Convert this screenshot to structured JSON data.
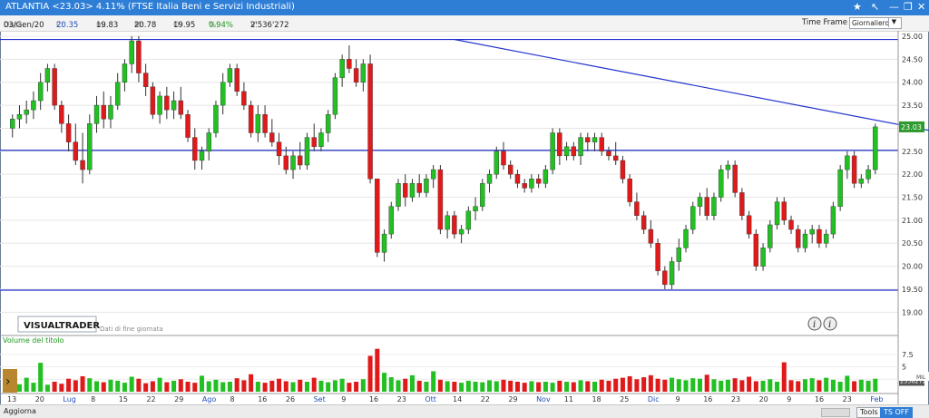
{
  "titlebar": {
    "title": "ATLANTIA <23.03> 4.11% (FTSE Italia Beni e Servizi Industriali)",
    "icons": [
      "star-icon",
      "arrow-nw-icon",
      "minimize-icon",
      "restore-icon",
      "close-icon"
    ]
  },
  "infobar": {
    "date_label": "Data:",
    "date": "03/Gen/20",
    "close_label": "C:",
    "close": "20.35",
    "min_label": "m:",
    "min": "19.83",
    "max_label": "M:",
    "max": "20.78",
    "open_label": "O:",
    "open": "19.95",
    "pct_label": "%:",
    "pct": "0.94%",
    "vol_label": "V:",
    "vol": "2'536'272",
    "timeframe_label": "Time Frame",
    "timeframe_value": "Giornaliero"
  },
  "branding": {
    "logo": "VISUALTRADER",
    "note": "Dati di fine giornata"
  },
  "volume_label": "Volume del titolo",
  "bottombar": {
    "update": "Aggiorna",
    "tools": "Tools",
    "tsoff": "TS OFF"
  },
  "colors": {
    "up": "#22c022",
    "down": "#e01a1a",
    "line": "#2233cc",
    "last_bg": "#2c9a2c"
  },
  "chart_data": [
    {
      "type": "candlestick",
      "title": "",
      "ylim": [
        18.75,
        25.0
      ],
      "yticks": [
        "25.00",
        "24.50",
        "24.00",
        "23.50",
        "23.00",
        "22.50",
        "22.00",
        "21.50",
        "21.00",
        "20.50",
        "20.00",
        "19.50",
        "19.00"
      ],
      "last_value_label": "23.03",
      "xticks": [
        "13",
        "20",
        "Lug",
        "8",
        "15",
        "22",
        "29",
        "Ago",
        "8",
        "16",
        "26",
        "Set",
        "9",
        "16",
        "23",
        "Ott",
        "14",
        "22",
        "29",
        "Nov",
        "11",
        "18",
        "25",
        "Dic",
        "9",
        "16",
        "23",
        "20",
        "9",
        "16",
        "23",
        "Feb"
      ],
      "month_ticks": [
        "Lug",
        "Ago",
        "Set",
        "Ott",
        "Nov",
        "Dic",
        "Feb"
      ],
      "horizontal_lines": [
        24.93,
        22.52,
        19.48
      ],
      "trendline": {
        "from": {
          "bar": 63,
          "price": 24.93
        },
        "to": {
          "bar": 201,
          "price": 20.9
        }
      },
      "candles": [
        {
          "o": 23.0,
          "h": 23.3,
          "l": 22.8,
          "c": 23.2
        },
        {
          "o": 23.2,
          "h": 23.5,
          "l": 23.0,
          "c": 23.3
        },
        {
          "o": 23.3,
          "h": 23.6,
          "l": 23.1,
          "c": 23.4
        },
        {
          "o": 23.4,
          "h": 23.8,
          "l": 23.2,
          "c": 23.6
        },
        {
          "o": 23.6,
          "h": 24.2,
          "l": 23.4,
          "c": 24.0
        },
        {
          "o": 24.0,
          "h": 24.4,
          "l": 23.8,
          "c": 24.3
        },
        {
          "o": 24.3,
          "h": 24.4,
          "l": 23.4,
          "c": 23.5
        },
        {
          "o": 23.5,
          "h": 23.6,
          "l": 22.9,
          "c": 23.1
        },
        {
          "o": 23.1,
          "h": 23.3,
          "l": 22.5,
          "c": 22.7
        },
        {
          "o": 22.7,
          "h": 23.1,
          "l": 22.2,
          "c": 22.3
        },
        {
          "o": 22.3,
          "h": 22.9,
          "l": 21.8,
          "c": 22.1
        },
        {
          "o": 22.1,
          "h": 23.3,
          "l": 22.0,
          "c": 23.1
        },
        {
          "o": 23.1,
          "h": 23.7,
          "l": 22.9,
          "c": 23.5
        },
        {
          "o": 23.5,
          "h": 23.8,
          "l": 23.0,
          "c": 23.2
        },
        {
          "o": 23.2,
          "h": 23.7,
          "l": 23.0,
          "c": 23.5
        },
        {
          "o": 23.5,
          "h": 24.2,
          "l": 23.4,
          "c": 24.0
        },
        {
          "o": 24.0,
          "h": 24.5,
          "l": 23.8,
          "c": 24.4
        },
        {
          "o": 24.4,
          "h": 25.0,
          "l": 24.2,
          "c": 24.9
        },
        {
          "o": 24.9,
          "h": 25.0,
          "l": 24.0,
          "c": 24.2
        },
        {
          "o": 24.2,
          "h": 24.4,
          "l": 23.7,
          "c": 23.9
        },
        {
          "o": 23.9,
          "h": 24.0,
          "l": 23.2,
          "c": 23.3
        },
        {
          "o": 23.3,
          "h": 23.8,
          "l": 23.1,
          "c": 23.7
        },
        {
          "o": 23.7,
          "h": 23.9,
          "l": 23.2,
          "c": 23.4
        },
        {
          "o": 23.4,
          "h": 23.8,
          "l": 23.2,
          "c": 23.6
        },
        {
          "o": 23.6,
          "h": 23.9,
          "l": 23.2,
          "c": 23.3
        },
        {
          "o": 23.3,
          "h": 23.4,
          "l": 22.7,
          "c": 22.8
        },
        {
          "o": 22.8,
          "h": 23.0,
          "l": 22.1,
          "c": 22.3
        },
        {
          "o": 22.3,
          "h": 22.6,
          "l": 22.1,
          "c": 22.5
        },
        {
          "o": 22.5,
          "h": 23.0,
          "l": 22.3,
          "c": 22.9
        },
        {
          "o": 22.9,
          "h": 23.6,
          "l": 22.8,
          "c": 23.5
        },
        {
          "o": 23.5,
          "h": 24.2,
          "l": 23.3,
          "c": 24.0
        },
        {
          "o": 24.0,
          "h": 24.4,
          "l": 23.9,
          "c": 24.3
        },
        {
          "o": 24.3,
          "h": 24.4,
          "l": 23.7,
          "c": 23.8
        },
        {
          "o": 23.8,
          "h": 24.0,
          "l": 23.4,
          "c": 23.5
        },
        {
          "o": 23.5,
          "h": 23.6,
          "l": 22.8,
          "c": 22.9
        },
        {
          "o": 22.9,
          "h": 23.5,
          "l": 22.7,
          "c": 23.3
        },
        {
          "o": 23.3,
          "h": 23.5,
          "l": 22.8,
          "c": 22.9
        },
        {
          "o": 22.9,
          "h": 23.2,
          "l": 22.6,
          "c": 22.7
        },
        {
          "o": 22.7,
          "h": 22.9,
          "l": 22.2,
          "c": 22.4
        },
        {
          "o": 22.4,
          "h": 22.6,
          "l": 22.0,
          "c": 22.1
        },
        {
          "o": 22.1,
          "h": 22.5,
          "l": 21.9,
          "c": 22.4
        },
        {
          "o": 22.4,
          "h": 22.7,
          "l": 22.1,
          "c": 22.2
        },
        {
          "o": 22.2,
          "h": 22.9,
          "l": 22.1,
          "c": 22.8
        },
        {
          "o": 22.8,
          "h": 23.1,
          "l": 22.5,
          "c": 22.6
        },
        {
          "o": 22.6,
          "h": 23.0,
          "l": 22.5,
          "c": 22.9
        },
        {
          "o": 22.9,
          "h": 23.4,
          "l": 22.7,
          "c": 23.3
        },
        {
          "o": 23.3,
          "h": 24.2,
          "l": 23.2,
          "c": 24.1
        },
        {
          "o": 24.1,
          "h": 24.6,
          "l": 23.9,
          "c": 24.5
        },
        {
          "o": 24.5,
          "h": 24.8,
          "l": 24.2,
          "c": 24.3
        },
        {
          "o": 24.3,
          "h": 24.5,
          "l": 23.9,
          "c": 24.0
        },
        {
          "o": 24.0,
          "h": 24.5,
          "l": 23.8,
          "c": 24.4
        },
        {
          "o": 24.4,
          "h": 24.6,
          "l": 21.8,
          "c": 21.9
        },
        {
          "o": 21.9,
          "h": 21.7,
          "l": 20.2,
          "c": 20.3
        },
        {
          "o": 20.3,
          "h": 20.8,
          "l": 20.1,
          "c": 20.7
        },
        {
          "o": 20.7,
          "h": 21.4,
          "l": 20.6,
          "c": 21.3
        },
        {
          "o": 21.3,
          "h": 21.9,
          "l": 21.2,
          "c": 21.8
        },
        {
          "o": 21.8,
          "h": 22.0,
          "l": 21.3,
          "c": 21.5
        },
        {
          "o": 21.5,
          "h": 21.9,
          "l": 21.4,
          "c": 21.8
        },
        {
          "o": 21.8,
          "h": 22.0,
          "l": 21.5,
          "c": 21.6
        },
        {
          "o": 21.6,
          "h": 22.0,
          "l": 21.5,
          "c": 21.9
        },
        {
          "o": 21.9,
          "h": 22.2,
          "l": 21.7,
          "c": 22.1
        },
        {
          "o": 22.1,
          "h": 22.2,
          "l": 20.7,
          "c": 20.8
        },
        {
          "o": 20.8,
          "h": 21.2,
          "l": 20.6,
          "c": 21.1
        },
        {
          "o": 21.1,
          "h": 21.2,
          "l": 20.6,
          "c": 20.7
        },
        {
          "o": 20.7,
          "h": 20.9,
          "l": 20.5,
          "c": 20.8
        },
        {
          "o": 20.8,
          "h": 21.3,
          "l": 20.7,
          "c": 21.2
        },
        {
          "o": 21.2,
          "h": 21.5,
          "l": 21.0,
          "c": 21.3
        },
        {
          "o": 21.3,
          "h": 21.9,
          "l": 21.2,
          "c": 21.8
        },
        {
          "o": 21.8,
          "h": 22.1,
          "l": 21.6,
          "c": 22.0
        },
        {
          "o": 22.0,
          "h": 22.6,
          "l": 21.9,
          "c": 22.5
        },
        {
          "o": 22.5,
          "h": 22.7,
          "l": 22.1,
          "c": 22.2
        },
        {
          "o": 22.2,
          "h": 22.3,
          "l": 21.9,
          "c": 22.0
        },
        {
          "o": 22.0,
          "h": 22.1,
          "l": 21.7,
          "c": 21.8
        },
        {
          "o": 21.8,
          "h": 21.9,
          "l": 21.6,
          "c": 21.7
        },
        {
          "o": 21.7,
          "h": 22.0,
          "l": 21.6,
          "c": 21.9
        },
        {
          "o": 21.9,
          "h": 22.0,
          "l": 21.7,
          "c": 21.8
        },
        {
          "o": 21.8,
          "h": 22.2,
          "l": 21.7,
          "c": 22.1
        },
        {
          "o": 22.1,
          "h": 23.0,
          "l": 22.0,
          "c": 22.9
        },
        {
          "o": 22.9,
          "h": 23.0,
          "l": 22.2,
          "c": 22.4
        },
        {
          "o": 22.4,
          "h": 22.7,
          "l": 22.3,
          "c": 22.6
        },
        {
          "o": 22.6,
          "h": 22.7,
          "l": 22.3,
          "c": 22.4
        },
        {
          "o": 22.4,
          "h": 22.9,
          "l": 22.2,
          "c": 22.8
        },
        {
          "o": 22.8,
          "h": 22.9,
          "l": 22.5,
          "c": 22.7
        },
        {
          "o": 22.7,
          "h": 22.9,
          "l": 22.5,
          "c": 22.8
        },
        {
          "o": 22.8,
          "h": 22.9,
          "l": 22.4,
          "c": 22.5
        },
        {
          "o": 22.5,
          "h": 22.6,
          "l": 22.3,
          "c": 22.4
        },
        {
          "o": 22.4,
          "h": 22.7,
          "l": 22.2,
          "c": 22.3
        },
        {
          "o": 22.3,
          "h": 22.4,
          "l": 21.8,
          "c": 21.9
        },
        {
          "o": 21.9,
          "h": 22.0,
          "l": 21.3,
          "c": 21.4
        },
        {
          "o": 21.4,
          "h": 21.6,
          "l": 21.0,
          "c": 21.1
        },
        {
          "o": 21.1,
          "h": 21.2,
          "l": 20.7,
          "c": 20.8
        },
        {
          "o": 20.8,
          "h": 21.0,
          "l": 20.4,
          "c": 20.5
        },
        {
          "o": 20.5,
          "h": 20.6,
          "l": 19.8,
          "c": 19.9
        },
        {
          "o": 19.9,
          "h": 20.0,
          "l": 19.5,
          "c": 19.6
        },
        {
          "o": 19.6,
          "h": 20.2,
          "l": 19.5,
          "c": 20.1
        },
        {
          "o": 20.1,
          "h": 20.6,
          "l": 19.9,
          "c": 20.4
        },
        {
          "o": 20.4,
          "h": 20.9,
          "l": 20.3,
          "c": 20.8
        },
        {
          "o": 20.8,
          "h": 21.4,
          "l": 20.7,
          "c": 21.3
        },
        {
          "o": 21.3,
          "h": 21.6,
          "l": 21.1,
          "c": 21.5
        },
        {
          "o": 21.5,
          "h": 21.7,
          "l": 21.0,
          "c": 21.1
        },
        {
          "o": 21.1,
          "h": 21.6,
          "l": 21.0,
          "c": 21.5
        },
        {
          "o": 21.5,
          "h": 22.2,
          "l": 21.4,
          "c": 22.1
        },
        {
          "o": 22.1,
          "h": 22.3,
          "l": 21.9,
          "c": 22.2
        },
        {
          "o": 22.2,
          "h": 22.3,
          "l": 21.5,
          "c": 21.6
        },
        {
          "o": 21.6,
          "h": 21.7,
          "l": 21.0,
          "c": 21.1
        },
        {
          "o": 21.1,
          "h": 21.2,
          "l": 20.6,
          "c": 20.7
        },
        {
          "o": 20.7,
          "h": 20.8,
          "l": 19.9,
          "c": 20.0
        },
        {
          "o": 20.0,
          "h": 20.5,
          "l": 19.9,
          "c": 20.4
        },
        {
          "o": 20.4,
          "h": 21.0,
          "l": 20.3,
          "c": 20.9
        },
        {
          "o": 20.9,
          "h": 21.5,
          "l": 20.8,
          "c": 21.4
        },
        {
          "o": 21.4,
          "h": 21.5,
          "l": 20.9,
          "c": 21.0
        },
        {
          "o": 21.0,
          "h": 21.1,
          "l": 20.7,
          "c": 20.8
        },
        {
          "o": 20.8,
          "h": 20.9,
          "l": 20.3,
          "c": 20.4
        },
        {
          "o": 20.4,
          "h": 20.8,
          "l": 20.3,
          "c": 20.7
        },
        {
          "o": 20.7,
          "h": 20.9,
          "l": 20.5,
          "c": 20.8
        },
        {
          "o": 20.8,
          "h": 20.9,
          "l": 20.4,
          "c": 20.5
        },
        {
          "o": 20.5,
          "h": 20.8,
          "l": 20.4,
          "c": 20.7
        },
        {
          "o": 20.7,
          "h": 21.4,
          "l": 20.6,
          "c": 21.3
        },
        {
          "o": 21.3,
          "h": 22.2,
          "l": 21.2,
          "c": 22.1
        },
        {
          "o": 22.1,
          "h": 22.5,
          "l": 21.9,
          "c": 22.4
        },
        {
          "o": 22.4,
          "h": 22.5,
          "l": 21.7,
          "c": 21.8
        },
        {
          "o": 21.8,
          "h": 22.0,
          "l": 21.7,
          "c": 21.9
        },
        {
          "o": 21.9,
          "h": 22.2,
          "l": 21.8,
          "c": 22.1
        },
        {
          "o": 22.1,
          "h": 23.1,
          "l": 22.0,
          "c": 23.03
        }
      ],
      "volume": {
        "label": "Volume del titolo",
        "yticks": [
          "7.5",
          "5",
          "2.5"
        ],
        "ylim": [
          0,
          10
        ],
        "last_value_label": "2536272",
        "values": [
          2.0,
          1.5,
          2.8,
          1.8,
          5.8,
          1.4,
          2.0,
          1.6,
          2.6,
          2.3,
          3.1,
          2.7,
          2.1,
          1.9,
          2.4,
          2.2,
          1.8,
          3.0,
          2.6,
          1.7,
          2.1,
          2.8,
          1.9,
          2.2,
          2.5,
          2.0,
          1.8,
          3.2,
          2.1,
          2.4,
          1.9,
          2.0,
          2.7,
          2.3,
          3.5,
          2.0,
          1.8,
          2.2,
          2.6,
          2.1,
          1.9,
          2.4,
          2.0,
          2.8,
          2.2,
          1.9,
          2.3,
          2.6,
          1.8,
          2.0,
          2.5,
          7.2,
          8.6,
          3.8,
          2.9,
          2.3,
          2.6,
          3.3,
          2.2,
          2.0,
          4.1,
          2.4,
          2.1,
          2.0,
          1.8,
          2.2,
          2.0,
          1.9,
          2.3,
          2.1,
          2.4,
          2.2,
          2.0,
          1.8,
          2.1,
          1.9,
          2.0,
          1.8,
          2.2,
          2.0,
          1.9,
          2.3,
          2.1,
          2.0,
          2.4,
          2.2,
          2.6,
          2.8,
          3.1,
          2.5,
          2.9,
          3.3,
          2.6,
          2.4,
          2.8,
          2.5,
          2.3,
          2.7,
          2.6,
          3.4,
          2.5,
          2.2,
          2.4,
          2.7,
          2.3,
          3.0,
          2.1,
          2.2,
          2.5,
          2.0,
          5.9,
          2.3,
          2.1,
          2.5,
          2.7,
          2.3,
          2.8,
          2.4,
          2.0,
          3.2,
          2.1,
          2.4,
          2.2,
          2.6,
          3.0,
          2.4,
          3.3,
          2.3,
          2.7,
          2.1
        ]
      }
    }
  ]
}
